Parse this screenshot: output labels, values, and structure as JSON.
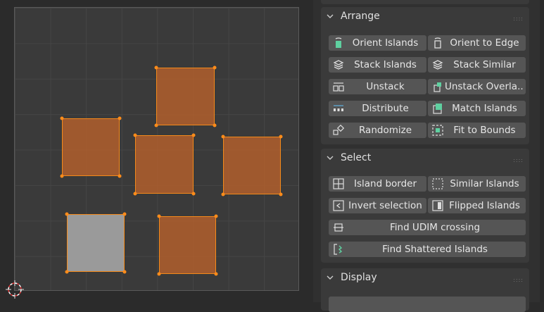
{
  "viewport": {
    "islands": [
      {
        "name": "island-top",
        "selected": true
      },
      {
        "name": "island-left",
        "selected": true
      },
      {
        "name": "island-center",
        "selected": true
      },
      {
        "name": "island-right",
        "selected": true
      },
      {
        "name": "island-bottom-left",
        "selected": false
      },
      {
        "name": "island-bottom-right",
        "selected": true
      }
    ]
  },
  "arrange": {
    "title": "Arrange",
    "buttons": [
      {
        "label": "Orient Islands",
        "icon": "orient-islands-icon"
      },
      {
        "label": "Orient to Edge",
        "icon": "orient-edge-icon"
      },
      {
        "label": "Stack Islands",
        "icon": "stack-icon"
      },
      {
        "label": "Stack Similar",
        "icon": "stack-similar-icon"
      },
      {
        "label": "Unstack",
        "icon": "unstack-icon"
      },
      {
        "label": "Unstack Overla...",
        "icon": "unstack-overlap-icon"
      },
      {
        "label": "Distribute",
        "icon": "distribute-icon"
      },
      {
        "label": "Match Islands",
        "icon": "match-islands-icon"
      },
      {
        "label": "Randomize",
        "icon": "randomize-icon"
      },
      {
        "label": "Fit to Bounds",
        "icon": "fit-bounds-icon"
      }
    ]
  },
  "select": {
    "title": "Select",
    "buttons": [
      {
        "label": "Island border",
        "icon": "island-border-icon"
      },
      {
        "label": "Similar Islands",
        "icon": "similar-islands-icon"
      },
      {
        "label": "Invert selection",
        "icon": "invert-selection-icon"
      },
      {
        "label": "Flipped Islands",
        "icon": "flipped-islands-icon"
      },
      {
        "label": "Find UDIM crossing",
        "icon": "udim-crossing-icon"
      },
      {
        "label": "Find Shattered Islands",
        "icon": "shattered-islands-icon"
      }
    ]
  },
  "display": {
    "title": "Display"
  },
  "colors": {
    "island_fill": "#b15f2d",
    "island_edge": "#f58a1a",
    "button": "#555555",
    "panel": "#3a3a3a"
  }
}
